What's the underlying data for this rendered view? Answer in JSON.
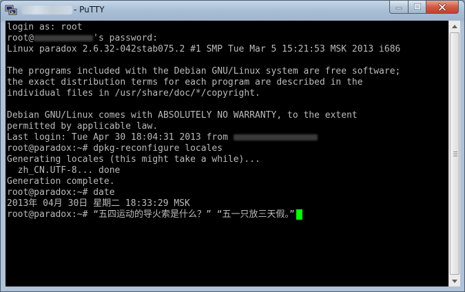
{
  "window": {
    "title": "- PuTTY",
    "title_icon": "putty-app-icon",
    "controls": {
      "minimize_icon": "minimize-icon",
      "maximize_icon": "maximize-icon",
      "close_icon": "close-icon"
    }
  },
  "terminal": {
    "background_color": "#000000",
    "text_color": "#bbbbbb",
    "cursor_color": "#00ff00",
    "lines": {
      "l0": "login as: root",
      "l1a": "root@",
      "l1b": "'s password:",
      "l2": "Linux paradox 2.6.32-042stab075.2 #1 SMP Tue Mar 5 15:21:53 MSK 2013 i686",
      "l3": "",
      "l4": "The programs included with the Debian GNU/Linux system are free software;",
      "l5": "the exact distribution terms for each program are described in the",
      "l6": "individual files in /usr/share/doc/*/copyright.",
      "l7": "",
      "l8": "Debian GNU/Linux comes with ABSOLUTELY NO WARRANTY, to the extent",
      "l9": "permitted by applicable law.",
      "l10": "Last login: Tue Apr 30 18:04:31 2013 from",
      "l11": "root@paradox:~# dpkg-reconfigure locales",
      "l12": "Generating locales (this might take a while)...",
      "l13": "  zh_CN.UTF-8... done",
      "l14": "Generation complete.",
      "l15": "root@paradox:~# date",
      "l16": "2013年 04月 30日 星期二 18:33:29 MSK",
      "l17": "root@paradox:~# “五四运动的导火索是什么？” “五一只放三天假。”"
    }
  }
}
